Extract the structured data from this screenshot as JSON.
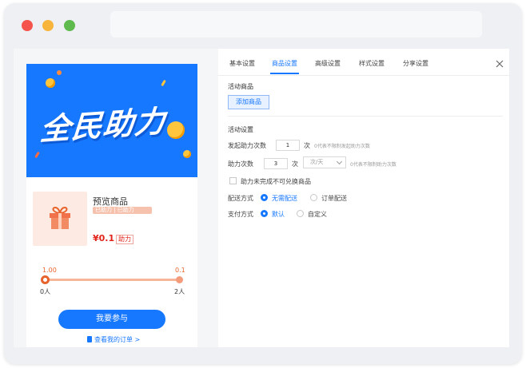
{
  "preview": {
    "banner_text": "全民助力",
    "product": {
      "title": "预览商品",
      "tags": "已助力 | 已助力",
      "price": "¥0.1",
      "price_badge": "助力"
    },
    "progress": {
      "top_left": "1.00",
      "top_right": "0.1",
      "bottom_left": "0人",
      "bottom_right": "2人"
    },
    "join_button": "我要参与",
    "orders_link": "查看我的订单 >"
  },
  "tabs": [
    {
      "label": "基本设置",
      "active": false
    },
    {
      "label": "商品设置",
      "active": true
    },
    {
      "label": "高级设置",
      "active": false
    },
    {
      "label": "样式设置",
      "active": false
    },
    {
      "label": "分享设置",
      "active": false
    }
  ],
  "activity_product": {
    "title": "活动商品",
    "add_button": "添加商品"
  },
  "activity_settings": {
    "title": "活动设置",
    "initiate": {
      "label": "发起助力次数",
      "value": "1",
      "unit": "次",
      "hint": "0代表不限制发起助力次数"
    },
    "assist": {
      "label": "助力次数",
      "value": "3",
      "unit": "次",
      "period": "次/天",
      "hint": "0代表不限制助力次数"
    },
    "exchange_checkbox": "助力未完成不可兑换商品",
    "delivery": {
      "label": "配送方式",
      "options": [
        "无需配送",
        "订单配送"
      ],
      "selected": 0
    },
    "payment": {
      "label": "支付方式",
      "options": [
        "默认",
        "自定义"
      ],
      "selected": 0
    }
  },
  "colors": {
    "accent": "#1677ff",
    "price": "#e2231a",
    "progress": "#e8632c"
  }
}
